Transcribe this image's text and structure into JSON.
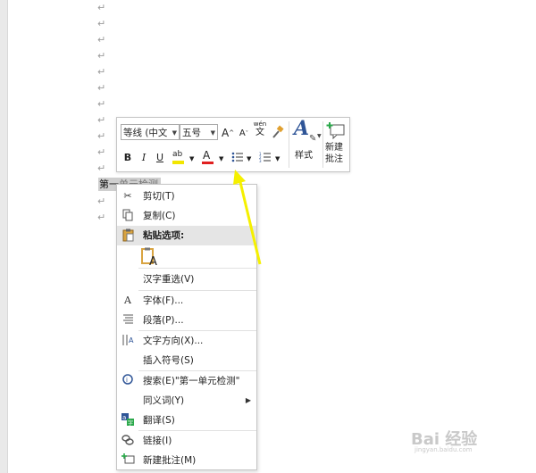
{
  "document": {
    "paragraph_mark": "↵",
    "selected_text": "第一单元检测",
    "selected_text_visible": "第一",
    "selected_text_tail": "单元检测"
  },
  "mini_toolbar": {
    "font_name": "等线 (中文",
    "font_size": "五号",
    "grow_font": "A",
    "shrink_font": "A",
    "phonetic_guide_top": "wén",
    "phonetic_guide_char": "文",
    "bold": "B",
    "italic": "I",
    "underline": "U",
    "highlight_glyph": "ab",
    "font_color_glyph": "A",
    "styles_label": "样式",
    "new_comment_label_line1": "新建",
    "new_comment_label_line2": "批注",
    "highlight_color": "#f2e600",
    "font_color": "#e02020"
  },
  "context_menu": {
    "cut": "剪切(T)",
    "copy": "复制(C)",
    "paste_options": "粘贴选项:",
    "reconvert": "汉字重选(V)",
    "font": "字体(F)...",
    "paragraph": "段落(P)...",
    "text_direction": "文字方向(X)...",
    "insert_symbol": "插入符号(S)",
    "search": "搜索(E)\"第一单元检测\"",
    "synonyms": "同义词(Y)",
    "translate": "翻译(S)",
    "link": "链接(I)",
    "new_comment": "新建批注(M)"
  },
  "watermark": {
    "brand": "Bai 经验",
    "url": "jingyan.baidu.com"
  },
  "colors": {
    "arrow": "#f5f000",
    "accent_blue": "#2f5597"
  }
}
